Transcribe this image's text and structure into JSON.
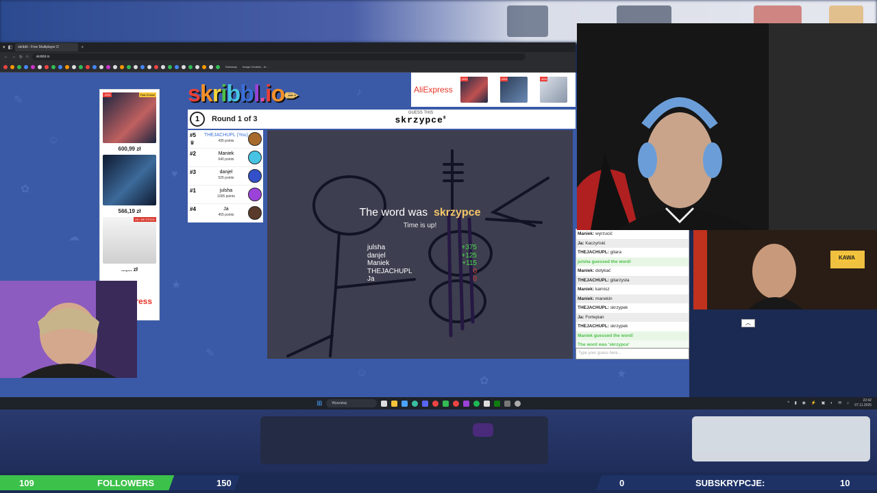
{
  "browser": {
    "tab_title": "skribbl - Free Multiplayer D",
    "url": "skribbl.io",
    "bookmarks": [
      "Kickaway",
      "Image Creation - Ie..."
    ]
  },
  "ads": {
    "left": {
      "badge": "-53%",
      "fast_choice": "Fast Choice",
      "prices": [
        "600,99 zł",
        "566,19 zł",
        "...,... zł"
      ],
      "stock_label": "US / DE STOCK",
      "brand_fragment": "ress"
    },
    "top": {
      "brand": "AliExpress",
      "badges": [
        "-52%",
        "-53%",
        "-49%"
      ]
    }
  },
  "game": {
    "logo": "skribbl.io",
    "round_number": "1",
    "round_label": "Round 1 of 3",
    "guess_label": "GUESS THIS",
    "guess_word": "skrzypce",
    "guess_length": "8",
    "players": [
      {
        "rank": "#5",
        "name": "THEJACHUPL (You)",
        "points": "435 points",
        "avatar_color": "#a86a2c"
      },
      {
        "rank": "#2",
        "name": "Maniek",
        "points": "640 points",
        "avatar_color": "#47c3e3"
      },
      {
        "rank": "#3",
        "name": "danjel",
        "points": "525 points",
        "avatar_color": "#3350c8"
      },
      {
        "rank": "#1",
        "name": "julsha",
        "points": "1005 points",
        "avatar_color": "#9b42d9"
      },
      {
        "rank": "#4",
        "name": "Ja",
        "points": "455 points",
        "avatar_color": "#5a3a2a"
      }
    ],
    "overlay": {
      "title_prefix": "The word was",
      "word": "skrzypce",
      "subtitle": "Time is up!"
    },
    "results": [
      {
        "name": "julsha",
        "score": "+375"
      },
      {
        "name": "danjel",
        "score": "+125"
      },
      {
        "name": "Maniek",
        "score": "+115"
      },
      {
        "name": "THEJACHUPL",
        "score": "0"
      },
      {
        "name": "Ja",
        "score": "0"
      }
    ]
  },
  "chat": {
    "messages": [
      {
        "user": "Maniek:",
        "text": " wyrzucić",
        "kind": "normal"
      },
      {
        "user": "Ja:",
        "text": " Kaczyński",
        "kind": "alt"
      },
      {
        "user": "THEJACHUPL:",
        "text": " gitara",
        "kind": "normal"
      },
      {
        "user": "",
        "text": "julsha guessed the word!",
        "kind": "green"
      },
      {
        "user": "Maniek:",
        "text": " dotykać",
        "kind": "normal"
      },
      {
        "user": "THEJACHUPL:",
        "text": " gitarzysta",
        "kind": "alt"
      },
      {
        "user": "Maniek:",
        "text": " karnisz",
        "kind": "normal"
      },
      {
        "user": "Maniek:",
        "text": " manekin",
        "kind": "alt"
      },
      {
        "user": "THEJACHUPL:",
        "text": " skrzypek",
        "kind": "normal"
      },
      {
        "user": "Ja:",
        "text": " Fortepian",
        "kind": "alt"
      },
      {
        "user": "THEJACHUPL:",
        "text": " skrzypek",
        "kind": "normal"
      },
      {
        "user": "",
        "text": "Maniek guessed the word!",
        "kind": "green"
      },
      {
        "user": "",
        "text": "The word was 'skrzypce'",
        "kind": "green light"
      }
    ],
    "input_placeholder": "Type your guess here..."
  },
  "webcam": {
    "label_kawa": "KAWA"
  },
  "taskbar": {
    "search_placeholder": "Wyszukaj",
    "time": "22:42",
    "date": "07.11.2025"
  },
  "stream": {
    "followers_current": "109",
    "followers_label": "FOLLOWERS",
    "followers_goal": "150",
    "subs_current": "0",
    "subs_label": "SUBSKRYPCJE:",
    "subs_goal": "10"
  },
  "colors": {
    "page_bg": "#3a5aa8",
    "followers_green": "#3cc14a",
    "subs_navy": "#1e3266",
    "guess_green": "#4dbf4a"
  }
}
